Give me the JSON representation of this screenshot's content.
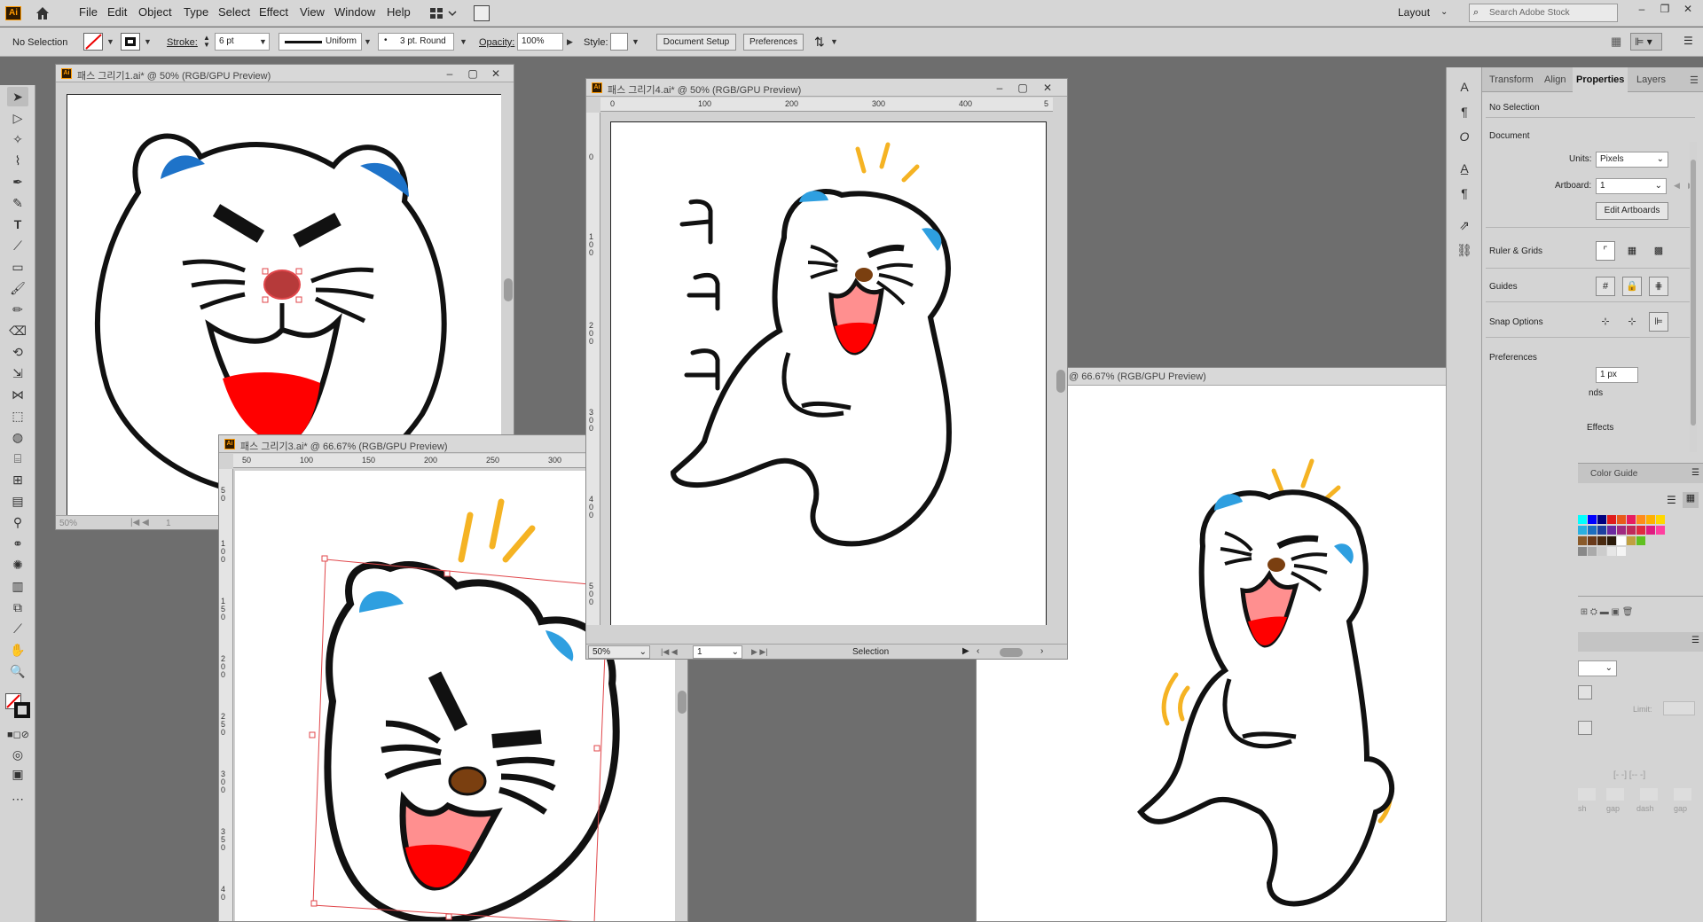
{
  "app": {
    "logo": "Ai"
  },
  "menu": {
    "items": [
      "File",
      "Edit",
      "Object",
      "Type",
      "Select",
      "Effect",
      "View",
      "Window",
      "Help"
    ],
    "layout_label": "Layout",
    "search_placeholder": "Search Adobe Stock"
  },
  "control": {
    "selection": "No Selection",
    "stroke_label": "Stroke:",
    "stroke_value": "6 pt",
    "profile": "Uniform",
    "brush": "3 pt. Round",
    "opacity_label": "Opacity:",
    "opacity_value": "100%",
    "style_label": "Style:",
    "document_setup": "Document Setup",
    "preferences": "Preferences"
  },
  "docs": {
    "doc1": {
      "title": "패스 그리기1.ai* @ 50% (RGB/GPU Preview)",
      "zoom": "50%",
      "page": "1"
    },
    "doc3": {
      "title": "패스 그리기3.ai* @ 66.67% (RGB/GPU Preview)",
      "ruler": [
        "50",
        "100",
        "150",
        "200",
        "250",
        "300"
      ],
      "vruler": [
        "5 0",
        "1 0 0",
        "1 5 0",
        "2 0 0",
        "2 5 0",
        "3 0 0",
        "3 5 0",
        "4 0"
      ]
    },
    "doc4": {
      "title": "패스 그리기4.ai* @ 50% (RGB/GPU Preview)",
      "ruler": [
        "0",
        "100",
        "200",
        "300",
        "400",
        "5"
      ],
      "vruler": [
        "0",
        "1 0 0",
        "2 0 0",
        "3 0 0",
        "4 0 0",
        "5 0 0"
      ],
      "zoom": "50%",
      "page": "1",
      "status": "Selection"
    },
    "doc5": {
      "title": "@ 66.67% (RGB/GPU Preview)"
    }
  },
  "props": {
    "tabs": [
      "Transform",
      "Align",
      "Properties",
      "Layers"
    ],
    "selection": "No Selection",
    "document": "Document",
    "units_label": "Units:",
    "units_value": "Pixels",
    "artboard_label": "Artboard:",
    "artboard_value": "1",
    "edit_artboards": "Edit Artboards",
    "ruler_grids": "Ruler & Grids",
    "guides": "Guides",
    "snap": "Snap Options",
    "preferences": "Preferences",
    "keyboard_inc": "1 px",
    "partial1": "nds",
    "partial2": "Effects",
    "color_guide": "Color Guide",
    "limit": "Limit:",
    "cap1": "sh",
    "cap2": "gap",
    "cap3": "dash",
    "cap4": "gap"
  },
  "colors": {
    "blue": "#2e9fe0",
    "red": "#ff0000",
    "pink": "#ff8f8f",
    "brown": "#7a3f10",
    "yellow": "#f5b323",
    "selection": "#e0464a"
  }
}
